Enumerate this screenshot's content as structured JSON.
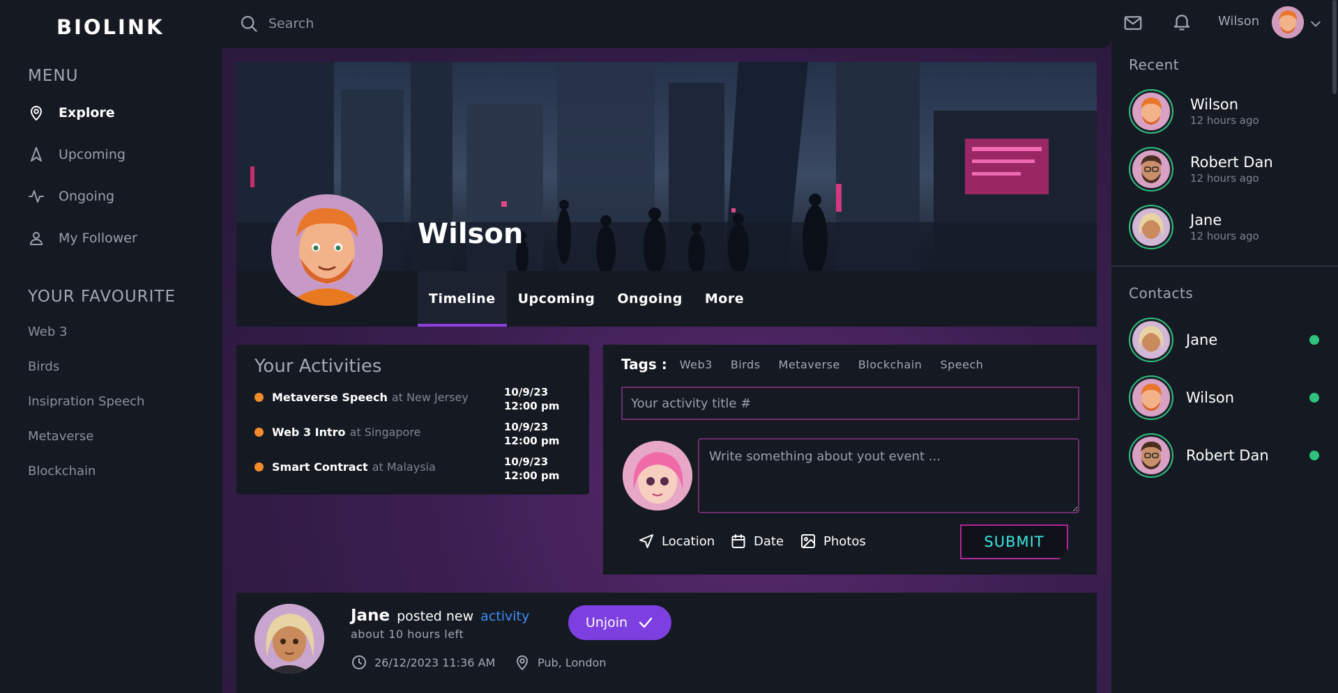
{
  "app": {
    "logo": "BIOLINK"
  },
  "sidebar": {
    "menu_title": "MENU",
    "menu": [
      {
        "label": "Explore",
        "icon": "location-pin-icon",
        "active": true
      },
      {
        "label": "Upcoming",
        "icon": "navigation-icon",
        "active": false
      },
      {
        "label": "Ongoing",
        "icon": "activity-icon",
        "active": false
      },
      {
        "label": "My Follower",
        "icon": "user-icon",
        "active": false
      }
    ],
    "favourite_title": "YOUR FAVOURITE",
    "favourites": [
      "Web 3",
      "Birds",
      "Insipration Speech",
      "Metaverse",
      "Blockchain"
    ]
  },
  "topbar": {
    "search_placeholder": "Search"
  },
  "profile": {
    "name": "Wilson",
    "tabs": [
      {
        "label": "Timeline",
        "active": true
      },
      {
        "label": "Upcoming",
        "active": false
      },
      {
        "label": "Ongoing",
        "active": false
      },
      {
        "label": "More",
        "active": false
      }
    ]
  },
  "activities": {
    "title": "Your Activities",
    "items": [
      {
        "title": "Metaverse Speech",
        "at": "at New Jersey",
        "date": "10/9/23",
        "time": "12:00 pm"
      },
      {
        "title": "Web 3 Intro",
        "at": "at Singapore",
        "date": "10/9/23",
        "time": "12:00 pm"
      },
      {
        "title": "Smart Contract",
        "at": "at Malaysia",
        "date": "10/9/23",
        "time": "12:00 pm"
      }
    ]
  },
  "post_form": {
    "tags_label": "Tags :",
    "tags": [
      "Web3",
      "Birds",
      "Metaverse",
      "Blockchain",
      "Speech"
    ],
    "title_placeholder": "Your activity title #",
    "desc_placeholder": "Write something about yout event ...",
    "actions": {
      "location": "Location",
      "date": "Date",
      "photos": "Photos"
    },
    "submit": "SUBMIT"
  },
  "feed": {
    "name": "Jane",
    "text": "posted new",
    "link": "activity",
    "sub": "about 10 hours left",
    "button": "Unjoin",
    "datetime": "26/12/2023 11:36 AM",
    "location": "Pub, London"
  },
  "right": {
    "user_name": "Wilson",
    "recent_title": "Recent",
    "recent": [
      {
        "name": "Wilson",
        "time": "12 hours ago"
      },
      {
        "name": "Robert Dan",
        "time": "12 hours ago"
      },
      {
        "name": "Jane",
        "time": "12 hours ago"
      }
    ],
    "contacts_title": "Contacts",
    "contacts": [
      {
        "name": "Jane",
        "online": true
      },
      {
        "name": "Wilson",
        "online": true
      },
      {
        "name": "Robert Dan",
        "online": true
      }
    ]
  },
  "colors": {
    "accent_purple": "#7d3fe0",
    "online_green": "#2ec27e",
    "activity_dot": "#f28b2b",
    "link_blue": "#3e8ef7",
    "submit_text": "#3ce6e2",
    "submit_border": "#b5249c"
  }
}
